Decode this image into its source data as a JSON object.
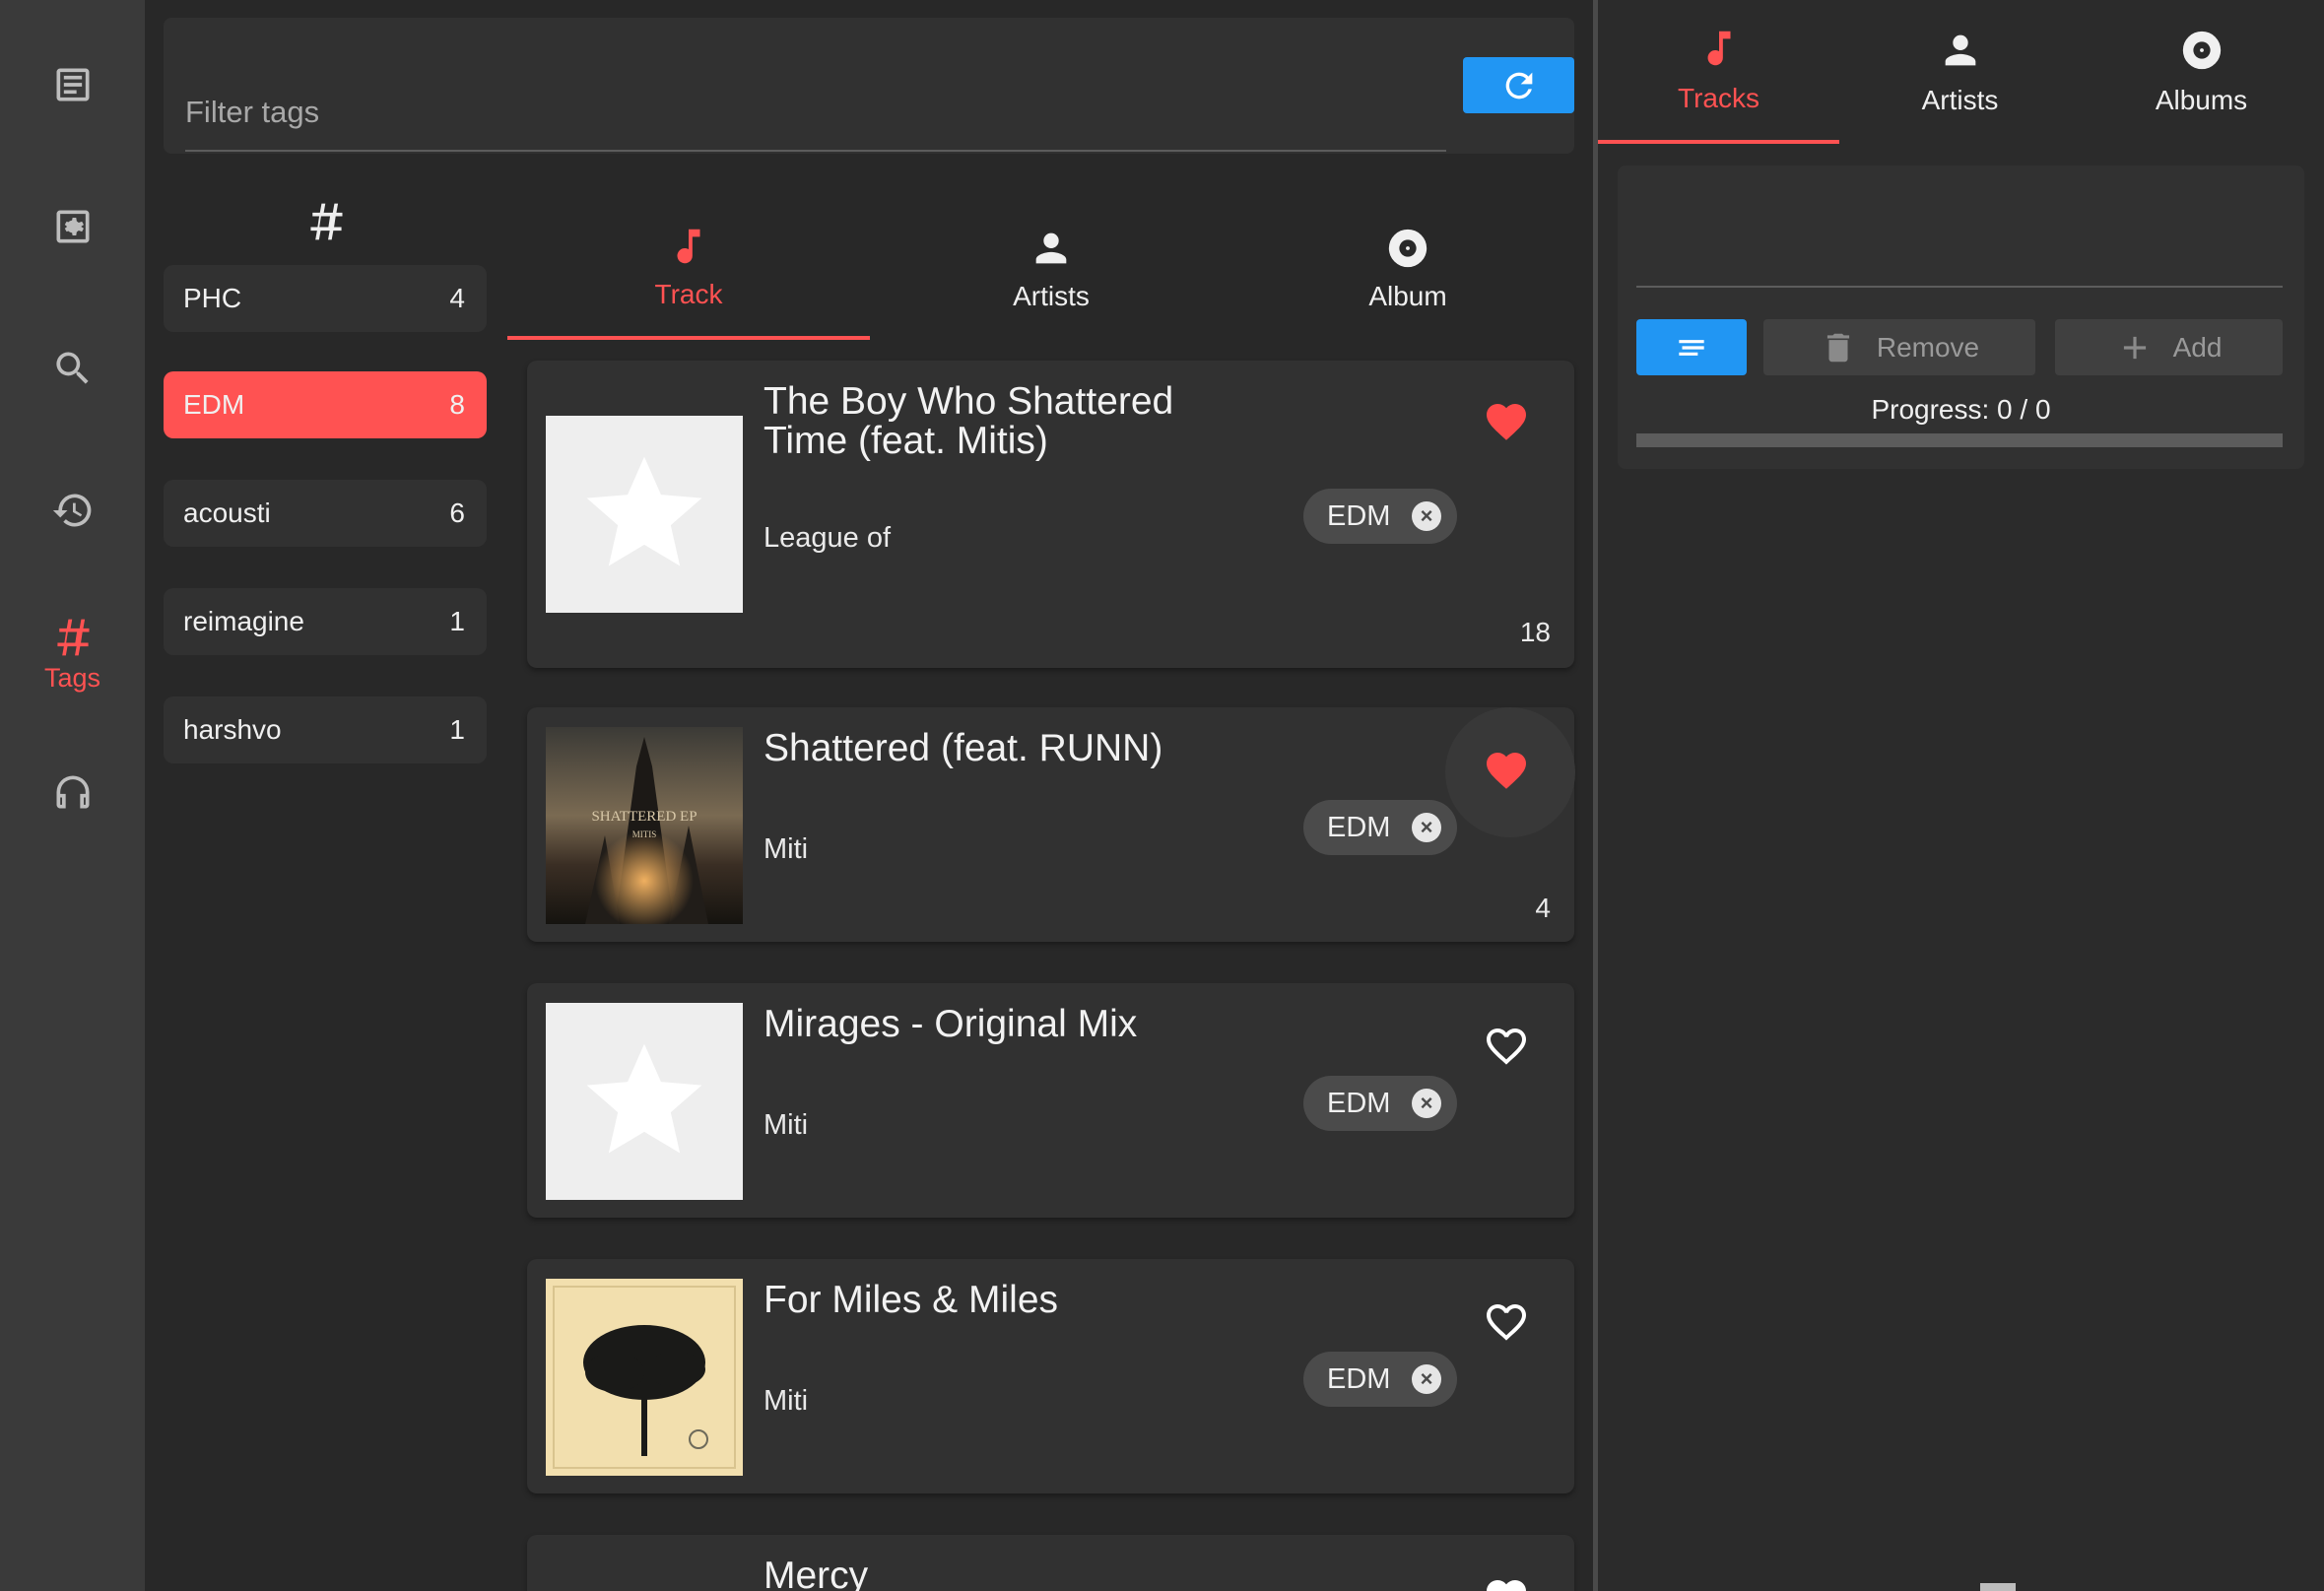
{
  "nav": {
    "items": [
      {
        "icon": "document-icon",
        "label": ""
      },
      {
        "icon": "settings-box-icon",
        "label": ""
      },
      {
        "icon": "search-icon",
        "label": ""
      },
      {
        "icon": "history-icon",
        "label": ""
      },
      {
        "icon": "hash-icon",
        "label": "Tags"
      },
      {
        "icon": "headphones-icon",
        "label": ""
      }
    ],
    "active_color": "#ff5252"
  },
  "filter": {
    "placeholder": "Filter tags",
    "value": "",
    "refresh_icon": "refresh-icon",
    "button_color": "#2196f3"
  },
  "tags": {
    "header_icon": "hash-icon",
    "items": [
      {
        "name": "PHC",
        "count": "4"
      },
      {
        "name": "EDM",
        "count": "8"
      },
      {
        "name": "acousti",
        "count": "6"
      },
      {
        "name": "reimagine",
        "count": "1"
      },
      {
        "name": "harshvo",
        "count": "1"
      }
    ],
    "selected": "EDM"
  },
  "content_tabs": [
    {
      "label": "Track",
      "icon": "music-note-icon"
    },
    {
      "label": "Artists",
      "icon": "person-icon"
    },
    {
      "label": "Album",
      "icon": "disc-icon"
    }
  ],
  "tracks": [
    {
      "title": "The Boy Who Shattered Time (feat. Mitis)",
      "artist": "League of",
      "tag": "EDM",
      "liked": true,
      "count": "18",
      "cover": "placeholder-star"
    },
    {
      "title": "Shattered (feat. RUNN)",
      "artist": "Miti",
      "tag": "EDM",
      "liked": true,
      "count": "4",
      "cover": "shattered-ep-artwork"
    },
    {
      "title": "Mirages - Original Mix",
      "artist": "Miti",
      "tag": "EDM",
      "liked": false,
      "count": "",
      "cover": "placeholder-star"
    },
    {
      "title": "For Miles & Miles",
      "artist": "Miti",
      "tag": "EDM",
      "liked": false,
      "count": "",
      "cover": "tree-artwork"
    },
    {
      "title": "Mercy",
      "artist": "",
      "tag": "",
      "liked": false,
      "count": "",
      "cover": ""
    }
  ],
  "cover_text": {
    "album": "SHATTERED EP",
    "artist": "MITIS"
  },
  "right_tabs": [
    {
      "label": "Tracks",
      "icon": "music-note-icon"
    },
    {
      "label": "Artists",
      "icon": "person-icon"
    },
    {
      "label": "Albums",
      "icon": "disc-icon"
    }
  ],
  "queue": {
    "input_value": "",
    "buttons": {
      "list_icon": "sort-icon",
      "remove": "Remove",
      "add": "Add"
    },
    "progress_text": "Progress: 0 / 0",
    "progress_fraction": 0
  },
  "colors": {
    "accent": "#ff5252",
    "primary": "#2196f3",
    "heart": "#ff4a4a"
  }
}
